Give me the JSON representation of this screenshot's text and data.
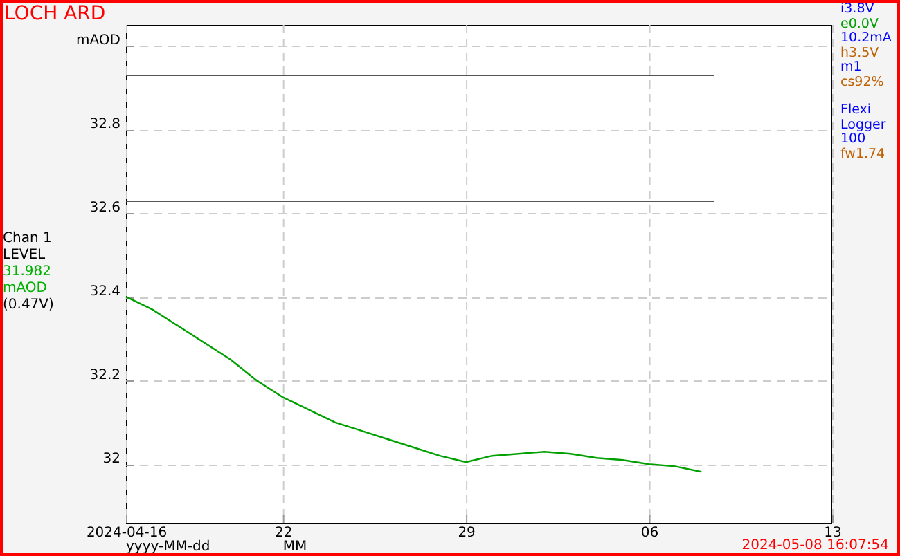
{
  "title": "LOCH ARD",
  "channel": {
    "lines": [
      {
        "text": "Chan 1",
        "color": "#000000"
      },
      {
        "text": "LEVEL",
        "color": "#000000"
      },
      {
        "text": "31.982",
        "color": "#00b000"
      },
      {
        "text": "mAOD",
        "color": "#00b000"
      },
      {
        "text": "(0.47V)",
        "color": "#000000"
      }
    ]
  },
  "status": [
    {
      "text": "i3.8V",
      "color": "#0000ff"
    },
    {
      "text": "e0.0V",
      "color": "#00a000"
    },
    {
      "text": "10.2mA",
      "color": "#0000ff"
    },
    {
      "text": "h3.5V",
      "color": "#c06000"
    },
    {
      "text": "m1",
      "color": "#0000ff"
    },
    {
      "text": "cs92%",
      "color": "#c06000"
    }
  ],
  "device": [
    {
      "text": "Flexi",
      "color": "#0000ff"
    },
    {
      "text": "Logger",
      "color": "#0000ff"
    },
    {
      "text": "100",
      "color": "#0000ff"
    },
    {
      "text": "fw1.74",
      "color": "#c06000"
    }
  ],
  "chart_data": {
    "type": "line",
    "xlabel": "yyyy-MM-dd",
    "x": [
      "2024-04-16",
      "2024-04-17",
      "2024-04-18",
      "2024-04-19",
      "2024-04-20",
      "2024-04-21",
      "2024-04-22",
      "2024-04-23",
      "2024-04-24",
      "2024-04-25",
      "2024-04-26",
      "2024-04-27",
      "2024-04-28",
      "2024-04-29",
      "2024-04-30",
      "2024-05-01",
      "2024-05-02",
      "2024-05-03",
      "2024-05-04",
      "2024-05-05",
      "2024-05-06",
      "2024-05-07",
      "2024-05-08"
    ],
    "series": [
      {
        "color": "#00a000",
        "values": [
          32.4,
          32.37,
          32.33,
          32.29,
          32.25,
          32.2,
          32.16,
          32.13,
          32.1,
          32.08,
          32.06,
          32.04,
          32.02,
          32.005,
          32.02,
          32.025,
          32.03,
          32.025,
          32.015,
          32.01,
          32.0,
          31.995,
          31.982
        ]
      }
    ],
    "xlim": [
      "2024-04-16",
      "2024-05-13"
    ],
    "grid": true,
    "ylim": [
      31.86,
      33.05
    ],
    "xticks": [
      {
        "value": "2024-04-16",
        "label": "2024-04-16"
      },
      {
        "value": "2024-04-22",
        "label": "22"
      },
      {
        "value": "2024-04-29",
        "label": "29"
      },
      {
        "value": "2024-05-06",
        "label": "06"
      },
      {
        "value": "2024-05-13",
        "label": "13"
      }
    ],
    "yticks": [
      {
        "value": 33,
        "label": "mAOD"
      },
      {
        "value": 32.8,
        "label": "32.8"
      },
      {
        "value": 32.6,
        "label": "32.6"
      },
      {
        "value": 32.4,
        "label": "32.4"
      },
      {
        "value": 32.2,
        "label": "32.2"
      },
      {
        "value": 32,
        "label": "32"
      }
    ],
    "ref_lines": [
      {
        "axis": "y",
        "value": 32.93
      },
      {
        "axis": "y",
        "value": 32.63
      }
    ]
  },
  "month_format": "MM",
  "timestamp": "2024-05-08 16:07:54"
}
